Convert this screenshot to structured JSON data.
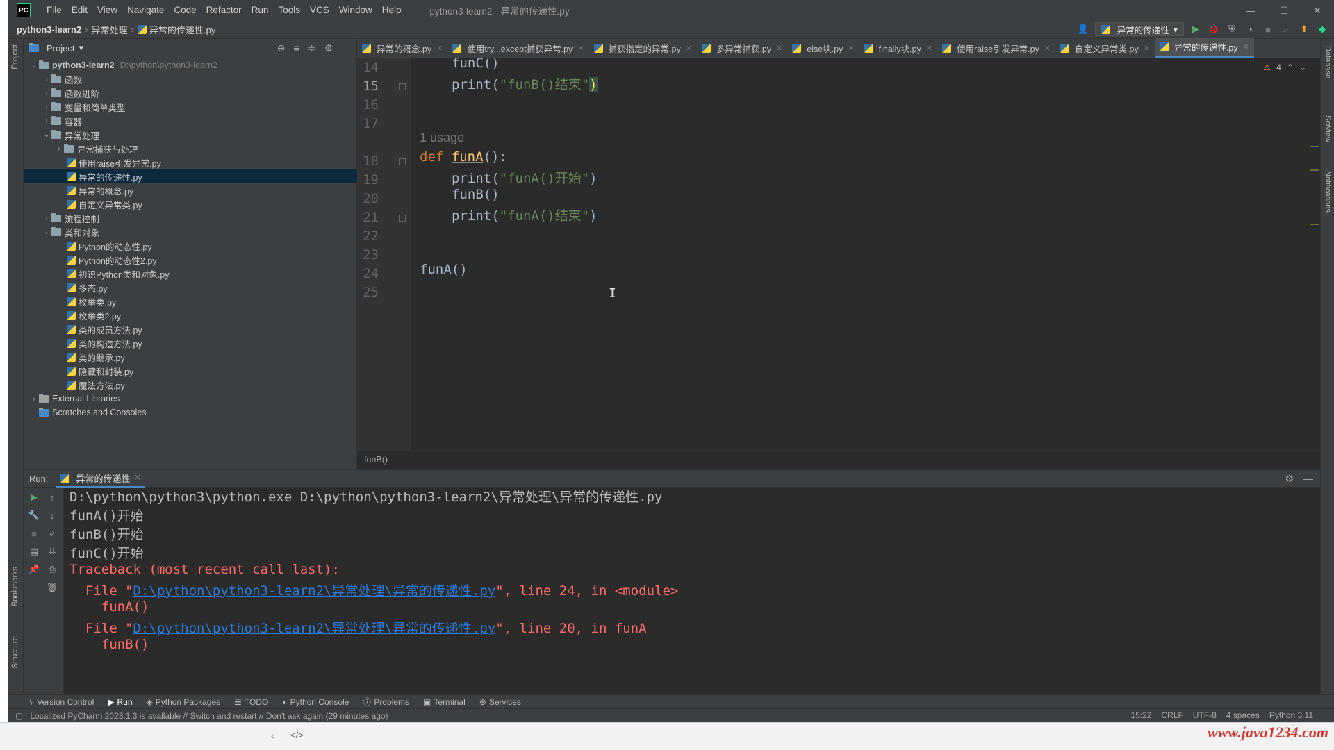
{
  "titlebar": {
    "logo": "PC",
    "menu": [
      "File",
      "Edit",
      "View",
      "Navigate",
      "Code",
      "Refactor",
      "Run",
      "Tools",
      "VCS",
      "Window",
      "Help"
    ],
    "title": "python3-learn2 - 异常的传递性.py"
  },
  "navbar": {
    "crumbs": [
      "python3-learn2",
      "异常处理",
      "异常的传递性.py"
    ],
    "run_config": "异常的传递性"
  },
  "project": {
    "header": "Project",
    "tree": [
      {
        "label": "python3-learn2",
        "hint": "D:\\python\\python3-learn2",
        "type": "root"
      },
      {
        "label": "函数",
        "type": "folder"
      },
      {
        "label": "函数进阶",
        "type": "folder"
      },
      {
        "label": "变量和简单类型",
        "type": "folder"
      },
      {
        "label": "容器",
        "type": "folder"
      },
      {
        "label": "异常处理",
        "type": "folder-open"
      },
      {
        "label": "异常捕获与处理",
        "type": "subfolder"
      },
      {
        "label": "使用raise引发异常.py",
        "type": "file"
      },
      {
        "label": "异常的传递性.py",
        "type": "file",
        "selected": true
      },
      {
        "label": "异常的概念.py",
        "type": "file"
      },
      {
        "label": "自定义异常类.py",
        "type": "file"
      },
      {
        "label": "流程控制",
        "type": "folder"
      },
      {
        "label": "类和对象",
        "type": "folder-open"
      },
      {
        "label": "Python的动态性.py",
        "type": "file"
      },
      {
        "label": "Python的动态性2.py",
        "type": "file"
      },
      {
        "label": "初识Python类和对象.py",
        "type": "file"
      },
      {
        "label": "多态.py",
        "type": "file"
      },
      {
        "label": "枚举类.py",
        "type": "file"
      },
      {
        "label": "枚举类2.py",
        "type": "file"
      },
      {
        "label": "类的成员方法.py",
        "type": "file"
      },
      {
        "label": "类的构造方法.py",
        "type": "file"
      },
      {
        "label": "类的继承.py",
        "type": "file"
      },
      {
        "label": "隐藏和封装.py",
        "type": "file"
      },
      {
        "label": "魔法方法.py",
        "type": "file"
      },
      {
        "label": "External Libraries",
        "type": "lib"
      },
      {
        "label": "Scratches and Consoles",
        "type": "scratch"
      }
    ]
  },
  "editor": {
    "tabs": [
      "异常的概念.py",
      "使用try...except捕获异常.py",
      "捕获指定的异常.py",
      "多异常捕获.py",
      "else块.py",
      "finally块.py",
      "使用raise引发异常.py",
      "自定义异常类.py",
      "异常的传递性.py"
    ],
    "active_tab": "异常的传递性.py",
    "warnings": "4",
    "lines": {
      "14": "14",
      "15": "15",
      "16": "16",
      "17": "17",
      "18": "18",
      "19": "19",
      "20": "20",
      "21": "21",
      "22": "22",
      "23": "23",
      "24": "24",
      "25": "25"
    },
    "code": {
      "l14": "funC()",
      "l15_pre": "print(",
      "l15_str": "\"funB()结束\"",
      "l15_post": ")",
      "usage": "1 usage",
      "l18_kw": "def ",
      "l18_fn": "funA",
      "l18_post": "():",
      "l19_pre": "print(",
      "l19_str": "\"funA()开始\"",
      "l19_post": ")",
      "l20": "funB()",
      "l21_pre": "print(",
      "l21_str": "\"funA()结束\"",
      "l21_post": ")",
      "l24": "funA()"
    },
    "breadcrumb": "funB()"
  },
  "run": {
    "label": "Run:",
    "tab": "异常的传递性",
    "console": {
      "cmd": "D:\\python\\python3\\python.exe D:\\python\\python3-learn2\\异常处理\\异常的传递性.py",
      "out1": "funA()开始",
      "out2": "funB()开始",
      "out3": "funC()开始",
      "tb": "Traceback (most recent call last):",
      "file_prefix": "  File \"",
      "file_path": "D:\\python\\python3-learn2\\异常处理\\异常的传递性.py",
      "file1_suffix": "\", line 24, in <module>",
      "src1": "    funA()",
      "file2_suffix": "\", line 20, in funA",
      "src2": "    funB()"
    }
  },
  "bottombar": [
    "Version Control",
    "Run",
    "Python Packages",
    "TODO",
    "Python Console",
    "Problems",
    "Terminal",
    "Services"
  ],
  "statusbar": {
    "message": "Localized PyCharm 2023.1.3 is available // Switch and restart // Don't ask again (29 minutes ago)",
    "position": "15:22",
    "line_sep": "CRLF",
    "encoding": "UTF-8",
    "indent": "4 spaces",
    "interpreter": "Python 3.11"
  },
  "side_labels": {
    "project": "Project",
    "bookmarks": "Bookmarks",
    "structure": "Structure",
    "database": "Database",
    "sciview": "SciView",
    "notifications": "Notifications"
  },
  "watermark": "www.java1234.com",
  "colors": {
    "accent": "#4a88c7",
    "error": "#ff6b68",
    "link": "#287bde",
    "keyword": "#cc7832",
    "string": "#6a8759",
    "function": "#ffc66d"
  }
}
